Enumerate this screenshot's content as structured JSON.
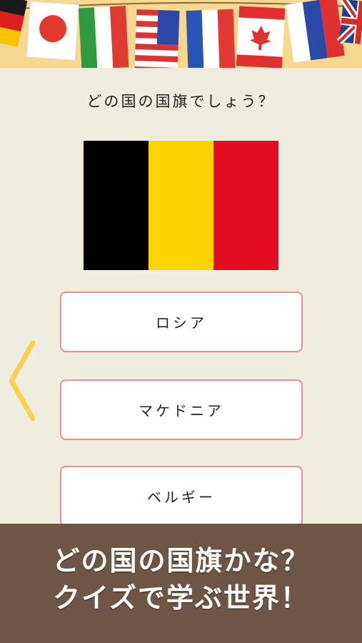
{
  "banner": {
    "flags": [
      "germany-flag",
      "japan-flag",
      "italy-flag",
      "usa-flag",
      "france-flag",
      "canada-flag",
      "russia-flag",
      "uk-flag"
    ]
  },
  "quiz": {
    "question": "どの国の国旗でしょう？",
    "flag_colors": [
      "#000000",
      "#fdd300",
      "#e30d22"
    ],
    "options": [
      "ロシア",
      "マケドニア",
      "ベルギー"
    ]
  },
  "navigation": {
    "back_icon": "chevron-left-icon",
    "accent": "#f7d34d"
  },
  "promo": {
    "line1": "どの国の国旗かな？",
    "line2": "クイズで学ぶ世界！"
  }
}
